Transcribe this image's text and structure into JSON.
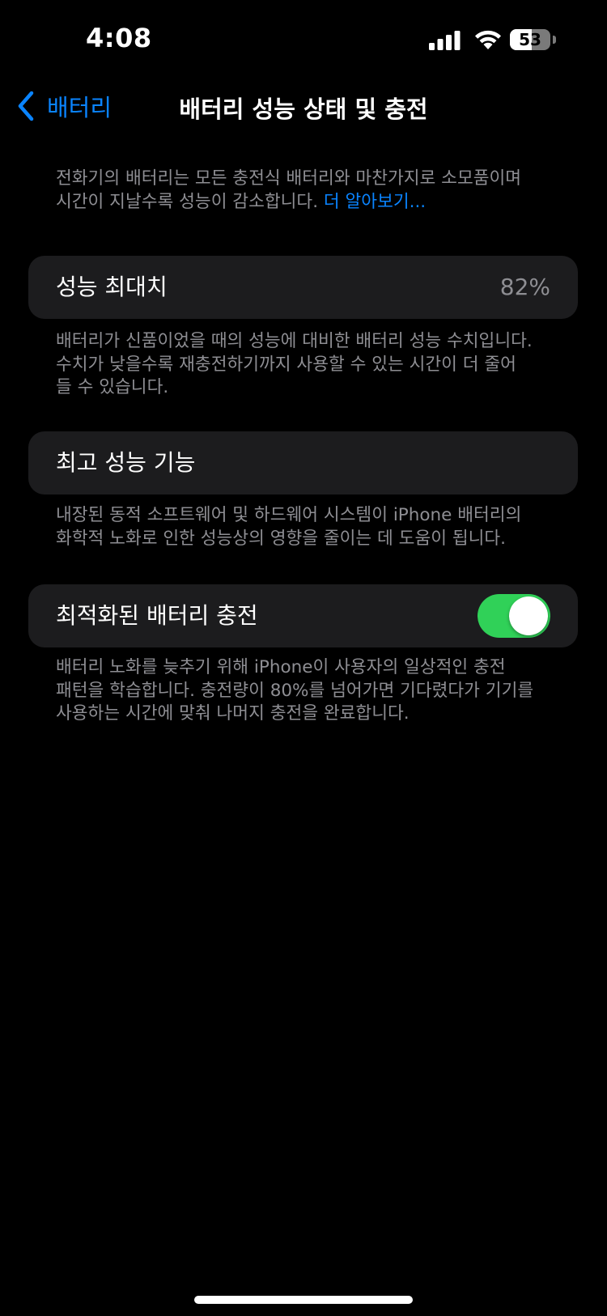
{
  "status_bar": {
    "time": "4:08",
    "battery_percent": "53",
    "battery_level": 0.53,
    "signal_bars": 4,
    "wifi": true
  },
  "nav": {
    "back_label": "배터리",
    "title": "배터리 성능 상태 및 충전"
  },
  "intro": {
    "line1": "전화기의 배터리는 모든 충전식 배터리와 마찬가지로 소모품이며",
    "line2": "시간이 지날수록 성능이 감소합니다.",
    "link": "더 알아보기..."
  },
  "max_capacity": {
    "label": "성능 최대치",
    "value": "82%",
    "footer": [
      "배터리가 신품이었을 때의 성능에 대비한 배터리 성능 수치입니다.",
      "수치가 낮을수록 재충전하기까지 사용할 수 있는 시간이 더 줄어",
      "들 수 있습니다."
    ]
  },
  "peak_performance": {
    "label": "최고 성능 기능",
    "footer": [
      "내장된 동적 소프트웨어 및 하드웨어 시스템이 iPhone 배터리의",
      "화학적 노화로 인한 성능상의 영향을 줄이는 데 도움이 됩니다."
    ]
  },
  "optimized_charging": {
    "label": "최적화된 배터리 충전",
    "enabled": true,
    "footer": [
      "배터리 노화를 늦추기 위해 iPhone이 사용자의 일상적인 충전",
      "패턴을 학습합니다. 충전량이 80%를 넘어가면 기다렸다가 기기를",
      "사용하는 시간에 맞춰 나머지 충전을 완료합니다."
    ]
  },
  "colors": {
    "background": "#000000",
    "cell": "#1c1c1e",
    "accent": "#0a84ff",
    "toggle_on": "#30d158",
    "secondary_text": "#8e8e93"
  }
}
